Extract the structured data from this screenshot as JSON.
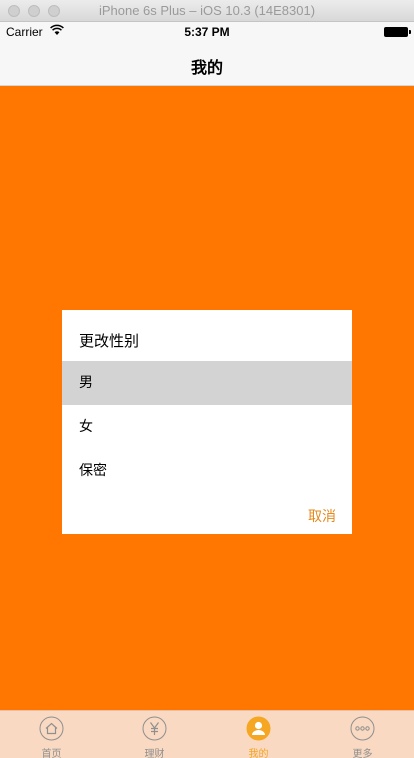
{
  "simulator": {
    "title": "iPhone 6s Plus – iOS 10.3 (14E8301)"
  },
  "statusbar": {
    "carrier": "Carrier",
    "time": "5:37 PM"
  },
  "navbar": {
    "title": "我的"
  },
  "dialog": {
    "title": "更改性别",
    "options": [
      "男",
      "女",
      "保密"
    ],
    "selected_index": 0,
    "cancel_label": "取消"
  },
  "tabbar": {
    "items": [
      {
        "label": "首页",
        "icon": "home-icon"
      },
      {
        "label": "理财",
        "icon": "yuan-icon"
      },
      {
        "label": "我的",
        "icon": "person-icon"
      },
      {
        "label": "更多",
        "icon": "more-icon"
      }
    ],
    "active_index": 2
  },
  "colors": {
    "background": "#ff7600",
    "accent": "#f5a623",
    "cancel": "#e48a1c",
    "tabbar": "#f9d9c1",
    "selected_option": "#d3d3d3"
  }
}
